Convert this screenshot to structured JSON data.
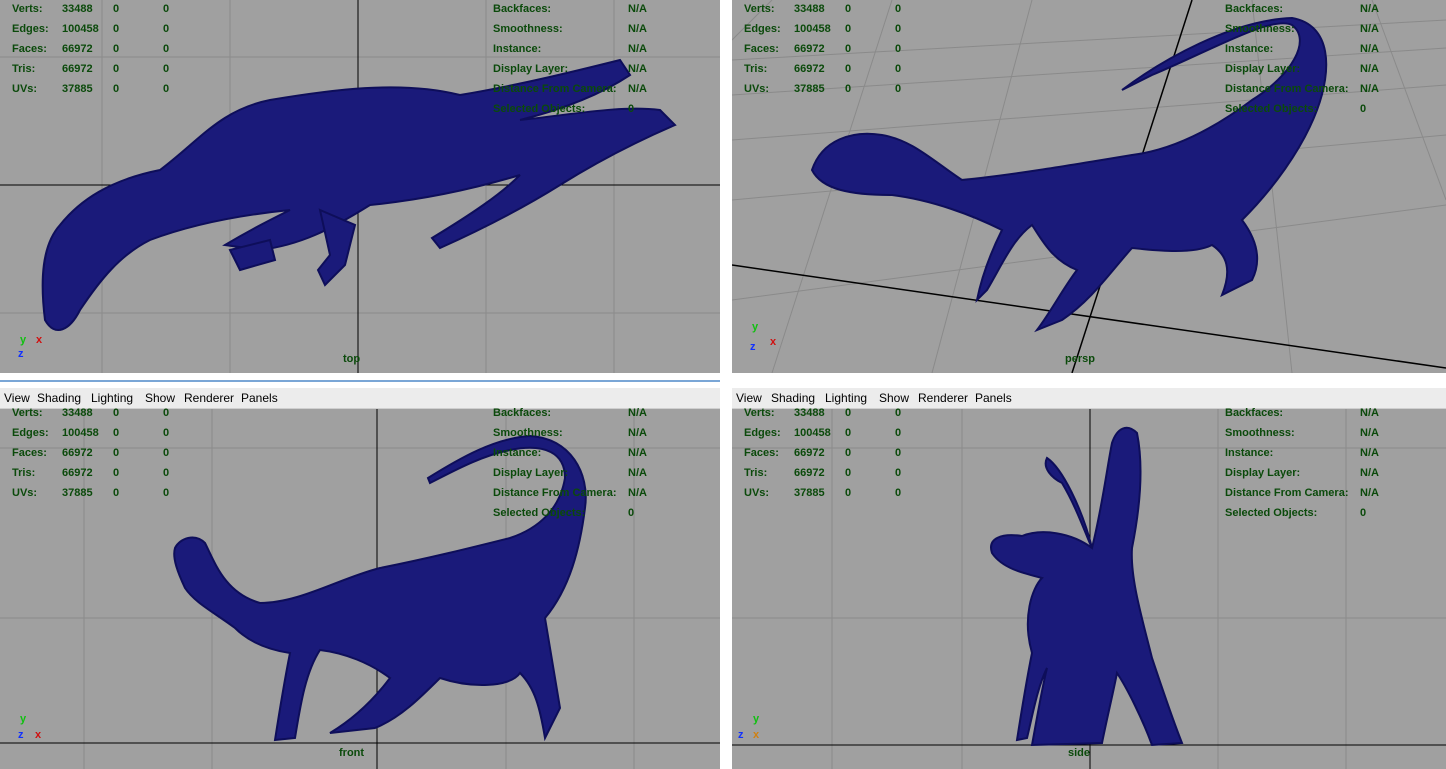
{
  "menu": [
    "View",
    "Shading",
    "Lighting",
    "Show",
    "Renderer",
    "Panels"
  ],
  "hud_left": [
    {
      "label": "Verts:",
      "value": "33488",
      "c1": "0",
      "c2": "0"
    },
    {
      "label": "Edges:",
      "value": "100458",
      "c1": "0",
      "c2": "0"
    },
    {
      "label": "Faces:",
      "value": "66972",
      "c1": "0",
      "c2": "0"
    },
    {
      "label": "Tris:",
      "value": "66972",
      "c1": "0",
      "c2": "0"
    },
    {
      "label": "UVs:",
      "value": "37885",
      "c1": "0",
      "c2": "0"
    }
  ],
  "hud_right": [
    {
      "label": "Backfaces:",
      "value": "N/A"
    },
    {
      "label": "Smoothness:",
      "value": "N/A"
    },
    {
      "label": "Instance:",
      "value": "N/A"
    },
    {
      "label": "Display Layer:",
      "value": "N/A"
    },
    {
      "label": "Distance From Camera:",
      "value": "N/A"
    },
    {
      "label": "Selected Objects:",
      "value": "0"
    }
  ],
  "viewports": {
    "top": {
      "camera": "top",
      "axis_up": "y",
      "axis_a": "z",
      "axis_b": "x"
    },
    "persp": {
      "camera": "persp",
      "axis_up": "y",
      "axis_a": "z",
      "axis_b": "x"
    },
    "front": {
      "camera": "front",
      "axis_up": "y",
      "axis_a": "z",
      "axis_b": "x"
    },
    "side": {
      "camera": "side",
      "axis_up": "y",
      "axis_a": "z",
      "axis_b": "x"
    }
  },
  "colors": {
    "viewport_bg": "#a0a0a0",
    "grid": "#8a8a8a",
    "grid_axis": "#000000",
    "mesh": "#1a1a7a",
    "hud_text": "#0b4a0b",
    "axis_x": "#d01010",
    "axis_y": "#10c010",
    "axis_z": "#1030ff"
  }
}
